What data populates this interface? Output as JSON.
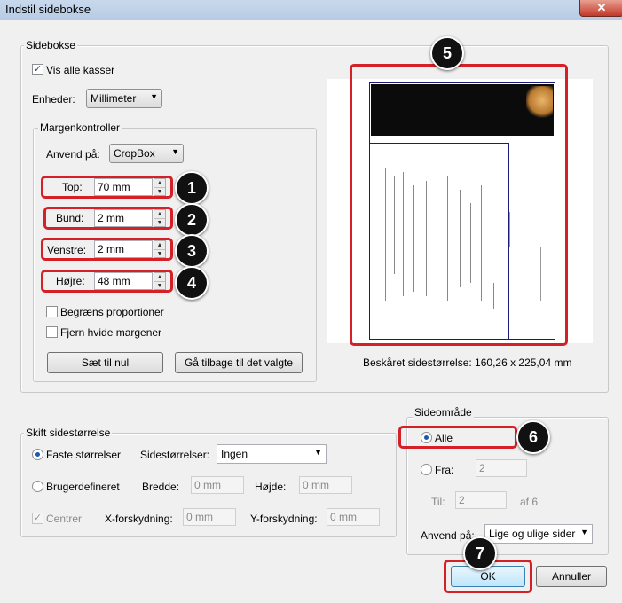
{
  "window": {
    "title": "Indstil sidebokse",
    "close_glyph": "✕"
  },
  "sidebokse": {
    "group_label": "Sidebokse",
    "show_all_label": "Vis alle kasser",
    "units_label": "Enheder:",
    "units_value": "Millimeter",
    "margin_group_label": "Margenkontroller",
    "apply_to_label": "Anvend på:",
    "apply_to_value": "CropBox",
    "top_label": "Top:",
    "top_value": "70 mm",
    "bottom_label": "Bund:",
    "bottom_value": "2 mm",
    "left_label": "Venstre:",
    "left_value": "2 mm",
    "right_label": "Højre:",
    "right_value": "48 mm",
    "constrain_label": "Begræns proportioner",
    "remove_white_label": "Fjern hvide margener",
    "reset_button": "Sæt til nul",
    "revert_button": "Gå tilbage til det valgte"
  },
  "preview": {
    "cropped_size_text": "Beskåret sidestørrelse: 160,26 x 225,04 mm"
  },
  "page_size": {
    "group_label": "Skift sidestørrelse",
    "fixed_label": "Faste størrelser",
    "sizes_label": "Sidestørrelser:",
    "sizes_value": "Ingen",
    "custom_label": "Brugerdefineret",
    "width_label": "Bredde:",
    "width_value": "0 mm",
    "height_label": "Højde:",
    "height_value": "0 mm",
    "center_label": "Centrer",
    "xoffset_label": "X-forskydning:",
    "xoffset_value": "0 mm",
    "yoffset_label": "Y-forskydning:",
    "yoffset_value": "0 mm"
  },
  "page_range": {
    "group_label": "Sideområde",
    "all_label": "Alle",
    "from_label": "Fra:",
    "from_value": "2",
    "to_label": "Til:",
    "to_value": "2",
    "of_text": "af 6",
    "apply_label": "Anvend på:",
    "apply_value": "Lige og ulige sider"
  },
  "buttons": {
    "ok": "OK",
    "cancel": "Annuller"
  },
  "callouts": [
    "1",
    "2",
    "3",
    "4",
    "5",
    "6",
    "7"
  ],
  "colors": {
    "callout_border": "#d42027",
    "callout_badge": "#111111"
  },
  "icons": {
    "spin_up": "▲",
    "spin_down": "▼",
    "dropdown": "▼",
    "check": "✓"
  }
}
